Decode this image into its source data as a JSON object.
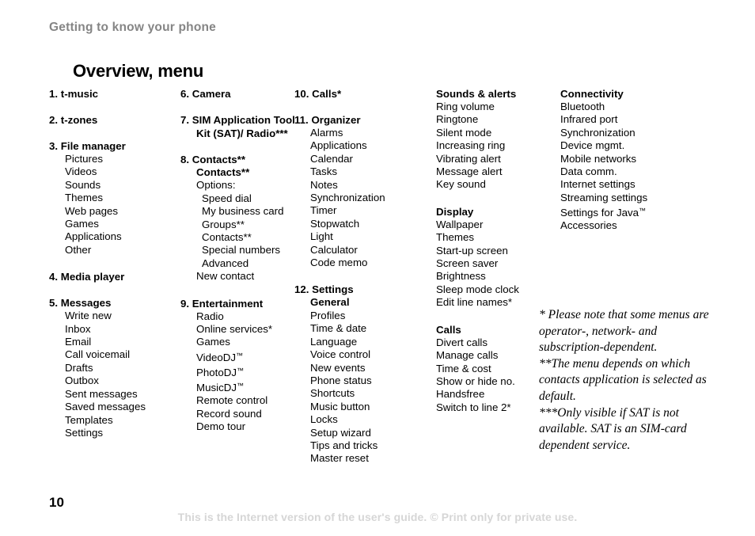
{
  "document": {
    "running_head": "Getting to know your phone",
    "title": "Overview, menu",
    "page_number": "10",
    "internet_notice": "This is the Internet version of the user's guide. © Print only for private use."
  },
  "colors": {
    "running_head": "#858585",
    "body_text": "#000000",
    "footer_notice": "#d6d6d6",
    "background": "#ffffff"
  },
  "columns": [
    {
      "id": "column-1",
      "groups": [
        {
          "heading": "1. t-music",
          "items": []
        },
        {
          "heading": "2. t-zones",
          "items": []
        },
        {
          "heading": "3. File manager",
          "items": [
            {
              "label": "Pictures",
              "level": 1,
              "bold": false
            },
            {
              "label": "Videos",
              "level": 1,
              "bold": false
            },
            {
              "label": "Sounds",
              "level": 1,
              "bold": false
            },
            {
              "label": "Themes",
              "level": 1,
              "bold": false
            },
            {
              "label": "Web pages",
              "level": 1,
              "bold": false
            },
            {
              "label": "Games",
              "level": 1,
              "bold": false
            },
            {
              "label": "Applications",
              "level": 1,
              "bold": false
            },
            {
              "label": "Other",
              "level": 1,
              "bold": false
            }
          ]
        },
        {
          "heading": "4. Media player",
          "items": []
        },
        {
          "heading": "5. Messages",
          "items": [
            {
              "label": "Write new",
              "level": 1,
              "bold": false
            },
            {
              "label": "Inbox",
              "level": 1,
              "bold": false
            },
            {
              "label": "Email",
              "level": 1,
              "bold": false
            },
            {
              "label": "Call voicemail",
              "level": 1,
              "bold": false
            },
            {
              "label": "Drafts",
              "level": 1,
              "bold": false
            },
            {
              "label": "Outbox",
              "level": 1,
              "bold": false
            },
            {
              "label": "Sent messages",
              "level": 1,
              "bold": false
            },
            {
              "label": "Saved messages",
              "level": 1,
              "bold": false
            },
            {
              "label": "Templates",
              "level": 1,
              "bold": false
            },
            {
              "label": "Settings",
              "level": 1,
              "bold": false
            }
          ]
        }
      ]
    },
    {
      "id": "column-2",
      "groups": [
        {
          "heading": "6. Camera",
          "items": []
        },
        {
          "heading": "7. SIM Application Tool Kit (SAT)/ Radio***",
          "items": []
        },
        {
          "heading": "8. Contacts**",
          "items": [
            {
              "label": "Contacts**",
              "level": 1,
              "bold": true
            },
            {
              "label": "Options:",
              "level": 1,
              "bold": false
            },
            {
              "label": "Speed dial",
              "level": 2,
              "bold": false
            },
            {
              "label": "My business card",
              "level": 2,
              "bold": false
            },
            {
              "label": "Groups**",
              "level": 2,
              "bold": false
            },
            {
              "label": "Contacts**",
              "level": 2,
              "bold": false
            },
            {
              "label": "Special numbers",
              "level": 2,
              "bold": false
            },
            {
              "label": "Advanced",
              "level": 2,
              "bold": false
            },
            {
              "label": "New contact",
              "level": 1,
              "bold": false
            }
          ]
        },
        {
          "heading": "9. Entertainment",
          "items": [
            {
              "label": "Radio",
              "level": 1,
              "bold": false
            },
            {
              "label": "Online services*",
              "level": 1,
              "bold": false
            },
            {
              "label": "Games",
              "level": 1,
              "bold": false
            },
            {
              "label": "VideoDJ™",
              "level": 1,
              "bold": false
            },
            {
              "label": "PhotoDJ™",
              "level": 1,
              "bold": false
            },
            {
              "label": "MusicDJ™",
              "level": 1,
              "bold": false
            },
            {
              "label": "Remote control",
              "level": 1,
              "bold": false
            },
            {
              "label": "Record sound",
              "level": 1,
              "bold": false
            },
            {
              "label": "Demo tour",
              "level": 1,
              "bold": false
            }
          ]
        }
      ]
    },
    {
      "id": "column-3",
      "groups": [
        {
          "heading": "10. Calls*",
          "items": []
        },
        {
          "heading": "11. Organizer",
          "items": [
            {
              "label": "Alarms",
              "level": 1,
              "bold": false
            },
            {
              "label": "Applications",
              "level": 1,
              "bold": false
            },
            {
              "label": "Calendar",
              "level": 1,
              "bold": false
            },
            {
              "label": "Tasks",
              "level": 1,
              "bold": false
            },
            {
              "label": "Notes",
              "level": 1,
              "bold": false
            },
            {
              "label": "Synchronization",
              "level": 1,
              "bold": false
            },
            {
              "label": "Timer",
              "level": 1,
              "bold": false
            },
            {
              "label": "Stopwatch",
              "level": 1,
              "bold": false
            },
            {
              "label": "Light",
              "level": 1,
              "bold": false
            },
            {
              "label": "Calculator",
              "level": 1,
              "bold": false
            },
            {
              "label": "Code memo",
              "level": 1,
              "bold": false
            }
          ]
        },
        {
          "heading": "12. Settings",
          "items": [
            {
              "label": "General",
              "level": 1,
              "bold": true
            },
            {
              "label": "Profiles",
              "level": 1,
              "bold": false
            },
            {
              "label": "Time & date",
              "level": 1,
              "bold": false
            },
            {
              "label": "Language",
              "level": 1,
              "bold": false
            },
            {
              "label": "Voice control",
              "level": 1,
              "bold": false
            },
            {
              "label": "New events",
              "level": 1,
              "bold": false
            },
            {
              "label": "Phone status",
              "level": 1,
              "bold": false
            },
            {
              "label": "Shortcuts",
              "level": 1,
              "bold": false
            },
            {
              "label": "Music button",
              "level": 1,
              "bold": false
            },
            {
              "label": "Locks",
              "level": 1,
              "bold": false
            },
            {
              "label": "Setup wizard",
              "level": 1,
              "bold": false
            },
            {
              "label": "Tips and tricks",
              "level": 1,
              "bold": false
            },
            {
              "label": "Master reset",
              "level": 1,
              "bold": false
            }
          ]
        }
      ]
    },
    {
      "id": "column-4",
      "groups": [
        {
          "heading": "Sounds & alerts",
          "items": [
            {
              "label": "Ring volume",
              "level": 0,
              "bold": false
            },
            {
              "label": "Ringtone",
              "level": 0,
              "bold": false
            },
            {
              "label": "Silent mode",
              "level": 0,
              "bold": false
            },
            {
              "label": "Increasing ring",
              "level": 0,
              "bold": false
            },
            {
              "label": "Vibrating alert",
              "level": 0,
              "bold": false
            },
            {
              "label": "Message alert",
              "level": 0,
              "bold": false
            },
            {
              "label": "Key sound",
              "level": 0,
              "bold": false
            }
          ]
        },
        {
          "heading": "Display",
          "items": [
            {
              "label": "Wallpaper",
              "level": 0,
              "bold": false
            },
            {
              "label": "Themes",
              "level": 0,
              "bold": false
            },
            {
              "label": "Start-up screen",
              "level": 0,
              "bold": false
            },
            {
              "label": "Screen saver",
              "level": 0,
              "bold": false
            },
            {
              "label": "Brightness",
              "level": 0,
              "bold": false
            },
            {
              "label": "Sleep mode clock",
              "level": 0,
              "bold": false
            },
            {
              "label": "Edit line names*",
              "level": 0,
              "bold": false
            }
          ]
        },
        {
          "heading": "Calls",
          "items": [
            {
              "label": "Divert calls",
              "level": 0,
              "bold": false
            },
            {
              "label": "Manage calls",
              "level": 0,
              "bold": false
            },
            {
              "label": "Time & cost",
              "level": 0,
              "bold": false
            },
            {
              "label": "Show or hide no.",
              "level": 0,
              "bold": false
            },
            {
              "label": "Handsfree",
              "level": 0,
              "bold": false
            },
            {
              "label": "Switch to line 2*",
              "level": 0,
              "bold": false
            }
          ]
        }
      ]
    },
    {
      "id": "column-5",
      "groups": [
        {
          "heading": "Connectivity",
          "items": [
            {
              "label": "Bluetooth",
              "level": 0,
              "bold": false
            },
            {
              "label": "Infrared port",
              "level": 0,
              "bold": false
            },
            {
              "label": "Synchronization",
              "level": 0,
              "bold": false
            },
            {
              "label": "Device mgmt.",
              "level": 0,
              "bold": false
            },
            {
              "label": "Mobile networks",
              "level": 0,
              "bold": false
            },
            {
              "label": "Data comm.",
              "level": 0,
              "bold": false
            },
            {
              "label": "Internet settings",
              "level": 0,
              "bold": false
            },
            {
              "label": "Streaming settings",
              "level": 0,
              "bold": false
            },
            {
              "label": "Settings for Java™",
              "level": 0,
              "bold": false
            },
            {
              "label": "Accessories",
              "level": 0,
              "bold": false
            }
          ]
        }
      ]
    }
  ],
  "footnotes": [
    "* Please note that some menus are operator-, network- and subscription-dependent.",
    "**The menu depends on which contacts application is selected as default.",
    "***Only visible if SAT is not available. SAT is an SIM-card dependent service."
  ]
}
